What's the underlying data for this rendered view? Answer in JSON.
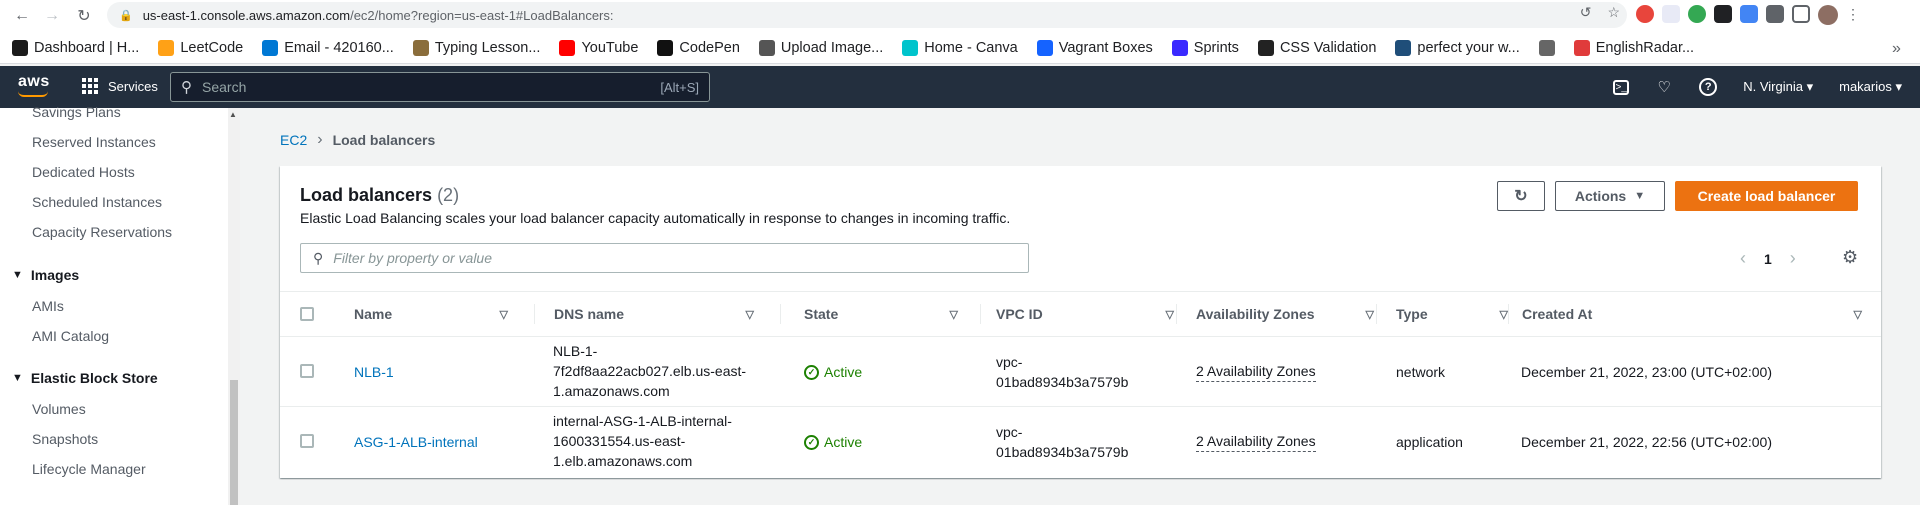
{
  "browser": {
    "url_host": "us-east-1.console.aws.amazon.com",
    "url_path": "/ec2/home?region=us-east-1#LoadBalancers:",
    "bookmarks": [
      {
        "label": "Dashboard | H...",
        "color": "#1b1b1b"
      },
      {
        "label": "LeetCode",
        "color": "#ffa116"
      },
      {
        "label": "Email - 420160...",
        "color": "#0078d4"
      },
      {
        "label": "Typing Lesson...",
        "color": "#8a6d3b"
      },
      {
        "label": "YouTube",
        "color": "#ff0000"
      },
      {
        "label": "CodePen",
        "color": "#111111"
      },
      {
        "label": "Upload Image...",
        "color": "#555555"
      },
      {
        "label": "Home - Canva",
        "color": "#00c4cc"
      },
      {
        "label": "Vagrant Boxes",
        "color": "#1563ff"
      },
      {
        "label": "Sprints",
        "color": "#3a29ff"
      },
      {
        "label": "CSS Validation",
        "color": "#222222"
      },
      {
        "label": "perfect your w...",
        "color": "#1f4e79"
      },
      {
        "label": "",
        "color": "#666666"
      },
      {
        "label": "EnglishRadar...",
        "color": "#e03b3b"
      }
    ]
  },
  "awsnav": {
    "logo": "aws",
    "services": "Services",
    "search_placeholder": "Search",
    "search_shortcut": "[Alt+S]",
    "region": "N. Virginia",
    "user": "makarios"
  },
  "sidebar": {
    "items_top": [
      "Savings Plans",
      "Reserved Instances",
      "Dedicated Hosts",
      "Scheduled Instances",
      "Capacity Reservations"
    ],
    "images_section": "Images",
    "images_items": [
      "AMIs",
      "AMI Catalog"
    ],
    "ebs_section": "Elastic Block Store",
    "ebs_items": [
      "Volumes",
      "Snapshots",
      "Lifecycle Manager"
    ]
  },
  "breadcrumb": {
    "root": "EC2",
    "current": "Load balancers"
  },
  "panel": {
    "title": "Load balancers",
    "count": "(2)",
    "description": "Elastic Load Balancing scales your load balancer capacity automatically in response to changes in incoming traffic.",
    "actions_label": "Actions",
    "create_label": "Create load balancer",
    "filter_placeholder": "Filter by property or value",
    "page_number": "1"
  },
  "table": {
    "columns": [
      "Name",
      "DNS name",
      "State",
      "VPC ID",
      "Availability Zones",
      "Type",
      "Created At"
    ],
    "rows": [
      {
        "name": "NLB-1",
        "dns": [
          "NLB-1-",
          "7f2df8aa22acb027.elb.us-east-",
          "1.amazonaws.com"
        ],
        "state": "Active",
        "vpc": [
          "vpc-",
          "01bad8934b3a7579b"
        ],
        "zones": "2 Availability Zones",
        "type": "network",
        "created": "December 21, 2022, 23:00 (UTC+02:00)"
      },
      {
        "name": "ASG-1-ALB-internal",
        "dns": [
          "internal-ASG-1-ALB-internal-",
          "1600331554.us-east-",
          "1.elb.amazonaws.com"
        ],
        "state": "Active",
        "vpc": [
          "vpc-",
          "01bad8934b3a7579b"
        ],
        "zones": "2 Availability Zones",
        "type": "application",
        "created": "December 21, 2022, 22:56 (UTC+02:00)"
      }
    ]
  }
}
